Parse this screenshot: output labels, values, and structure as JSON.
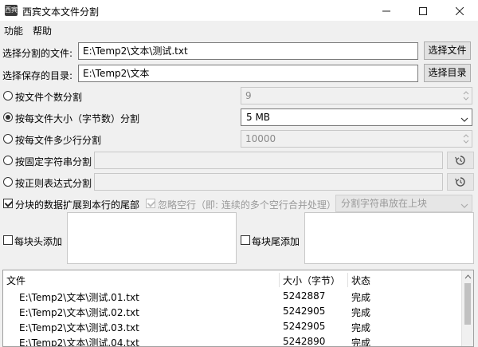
{
  "window": {
    "title": "西宾文本文件分割",
    "icon_text": "西宾"
  },
  "menu": [
    "功能",
    "帮助"
  ],
  "inputs": {
    "source_label": "选择分割的文件:",
    "source_value": "E:\\Temp2\\文本\\测试.txt",
    "source_button": "选择文件",
    "dest_label": "选择保存的目录:",
    "dest_value": "E:\\Temp2\\文本",
    "dest_button": "选择目录"
  },
  "options": {
    "by_count": {
      "label": "按文件个数分割",
      "value": "9",
      "selected": false
    },
    "by_size": {
      "label": "按每文件大小（字节数）分割",
      "value": "5 MB",
      "selected": true
    },
    "by_lines": {
      "label": "按每文件多少行分割",
      "value": "10000",
      "selected": false
    },
    "by_string": {
      "label": "按固定字符串分割",
      "value": "",
      "selected": false
    },
    "by_regex": {
      "label": "按正则表达式分割",
      "value": "",
      "selected": false
    }
  },
  "extend": {
    "label": "分块的数据扩展到本行的尾部",
    "checked": true,
    "ignore_label": "忽略空行（即: 连续的多个空行合并处理）",
    "ignore_checked": true,
    "position_combo": "分割字符串放在上块"
  },
  "header_add": {
    "label": "每块头添加",
    "checked": false
  },
  "footer_add": {
    "label": "每块尾添加",
    "checked": false
  },
  "table": {
    "columns": [
      "文件",
      "大小（字节）",
      "状态"
    ],
    "rows": [
      [
        "E:\\Temp2\\文本\\测试.01.txt",
        "5242887",
        "完成"
      ],
      [
        "E:\\Temp2\\文本\\测试.02.txt",
        "5242905",
        "完成"
      ],
      [
        "E:\\Temp2\\文本\\测试.03.txt",
        "5242905",
        "完成"
      ],
      [
        "E:\\Temp2\\文本\\测试.04.txt",
        "5242890",
        "完成"
      ]
    ]
  }
}
